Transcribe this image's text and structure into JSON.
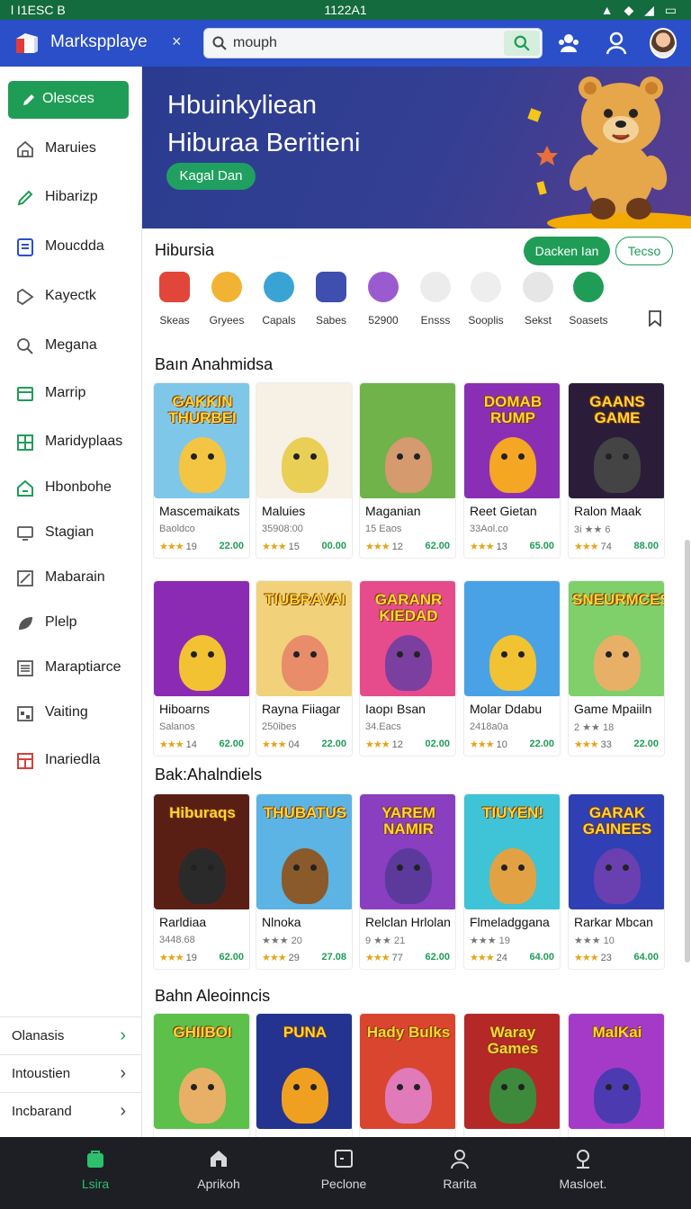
{
  "status_bar": {
    "left": "l I1ESC B",
    "time": "1122A1",
    "right": "▲ ◆ ◢ ▭"
  },
  "app": {
    "title": "Markspplaye",
    "close": "×"
  },
  "search": {
    "value": "mouph",
    "placeholder": "mouph"
  },
  "sidebar": {
    "primary": "Olesces",
    "items": [
      {
        "label": "Maruies",
        "icon": "home-icon"
      },
      {
        "label": "Hibarizp",
        "icon": "pencil-icon"
      },
      {
        "label": "Moucdda",
        "icon": "document-icon"
      },
      {
        "label": "Kayectk",
        "icon": "tag-icon"
      },
      {
        "label": "Megana",
        "icon": "search-icon"
      },
      {
        "label": "Marrip",
        "icon": "window-icon"
      },
      {
        "label": "Maridyplaas",
        "icon": "grid-icon"
      },
      {
        "label": "Hbonbohe",
        "icon": "house-icon"
      },
      {
        "label": "Stagian",
        "icon": "monitor-icon"
      },
      {
        "label": "Mabarain",
        "icon": "edit-icon"
      },
      {
        "label": "Plelp",
        "icon": "leaf-icon"
      },
      {
        "label": "Maraptiarce",
        "icon": "list-icon"
      },
      {
        "label": "Vaiting",
        "icon": "calendar-icon"
      },
      {
        "label": "Inariedla",
        "icon": "layout-icon"
      }
    ],
    "bottom": [
      "Olanasis",
      "Intoustien",
      "Incbarand"
    ]
  },
  "hero": {
    "line1": "Hbuinkyliean",
    "line2": "Hiburaa Beritieni",
    "cta": "Kagal Dan"
  },
  "categories_section": {
    "title": "Hibursia",
    "pill_primary": "Dacken Ian",
    "pill_secondary": "Tecso",
    "items": [
      {
        "label": "Skeas",
        "color": "#e2463a"
      },
      {
        "label": "Gryees",
        "color": "#f2b233"
      },
      {
        "label": "Capals",
        "color": "#39a3d6"
      },
      {
        "label": "Sabes",
        "color": "#3e4fb0"
      },
      {
        "label": "52900",
        "color": "#9b5bd0"
      },
      {
        "label": "Ensss",
        "color": "#d9d9d9"
      },
      {
        "label": "Sooplis",
        "color": "#e0e0e0"
      },
      {
        "label": "Sekst",
        "color": "#d0d0d0"
      },
      {
        "label": "Soasets",
        "color": "#1f9d57"
      }
    ]
  },
  "section1": {
    "title": "Baın Anahmidsa",
    "cards": [
      {
        "thumb_text": "GAKKIN THURBEI",
        "name": "Mascemaikats",
        "sub": "Baoldco",
        "stars": "★★★",
        "rating": "19",
        "price": "22.00",
        "bg": "#7fc7e8",
        "mascot": "#f4c542"
      },
      {
        "thumb_text": "",
        "name": "Maluies",
        "sub": "35908:00",
        "stars": "★★★",
        "rating": "15",
        "price": "00.00",
        "bg": "#f6f1e4",
        "mascot": "#e9cf56"
      },
      {
        "thumb_text": "",
        "name": "Maganian",
        "sub": "15 Eaos",
        "stars": "★★★",
        "rating": "12",
        "price": "62.00",
        "bg": "#6fb34a",
        "mascot": "#d59a6e"
      },
      {
        "thumb_text": "DOMAB RUMP",
        "name": "Reet Gietan",
        "sub": "33Aol.co",
        "stars": "★★★",
        "rating": "13",
        "price": "65.00",
        "bg": "#8a2fb5",
        "mascot": "#f5a623"
      },
      {
        "thumb_text": "GAANS GAME",
        "name": "Ralon Maak",
        "sub": "3i ★★ 6",
        "stars": "★★★",
        "rating": "74",
        "price": "88.00",
        "bg": "#2b1d3a",
        "mascot": "#444"
      }
    ]
  },
  "section2": {
    "cards": [
      {
        "thumb_text": "",
        "name": "Hiboarns",
        "sub": "Salanos",
        "stars": "★★★",
        "rating": "14",
        "price": "62.00",
        "bg": "#8b2bb3",
        "mascot": "#f2c232"
      },
      {
        "thumb_text": "TIUBRAVAI",
        "name": "Rayna Fiiagar",
        "sub": "250ibes",
        "stars": "★★★",
        "rating": "04",
        "price": "22.00",
        "bg": "#f1d17a",
        "mascot": "#e88c6a"
      },
      {
        "thumb_text": "GARANR KIEDAD",
        "name": "Iaopı Bsan",
        "sub": "34.Eacs",
        "stars": "★★★",
        "rating": "12",
        "price": "02.00",
        "bg": "#e64c8c",
        "mascot": "#7b3fa0"
      },
      {
        "thumb_text": "",
        "name": "Molar Ddabu",
        "sub": "2418a0a",
        "stars": "★★★",
        "rating": "10",
        "price": "22.00",
        "bg": "#4aa2e6",
        "mascot": "#f1c232"
      },
      {
        "thumb_text": "SNEURMCES",
        "name": "Game Mpaiiln",
        "sub": "2 ★★ 18",
        "stars": "★★★",
        "rating": "33",
        "price": "22.00",
        "bg": "#7fcf6b",
        "mascot": "#e8b067"
      }
    ]
  },
  "section3": {
    "title": "Bak:Ahalndiels",
    "cards": [
      {
        "thumb_text": "Hiburaqs",
        "name": "Rarldiaa",
        "sub": "3448.68",
        "stars": "★★★",
        "rating": "19",
        "price": "62.00",
        "bg": "#5a1f14",
        "mascot": "#2a2a2a"
      },
      {
        "thumb_text": "THUBATUS",
        "name": "Nlnoka",
        "sub": "★★★ 20",
        "stars": "★★★",
        "rating": "29",
        "price": "27.08",
        "bg": "#5bb4e3",
        "mascot": "#8a5a2b"
      },
      {
        "thumb_text": "YAREM NAMIR",
        "name": "Relclan Hrlolan",
        "sub": "9 ★★ 21",
        "stars": "★★★",
        "rating": "77",
        "price": "62.00",
        "bg": "#8a3ec0",
        "mascot": "#5b3a9c"
      },
      {
        "thumb_text": "TIUYEN!",
        "name": "Flmeladggana",
        "sub": "★★★ 19",
        "stars": "★★★",
        "rating": "24",
        "price": "64.00",
        "bg": "#3fc3d6",
        "mascot": "#e2a243"
      },
      {
        "thumb_text": "GARAK GAINEES",
        "name": "Rarkar Mbcan",
        "sub": "★★★ 10",
        "stars": "★★★",
        "rating": "23",
        "price": "64.00",
        "bg": "#2f3fb4",
        "mascot": "#6a3fb0"
      }
    ]
  },
  "section4": {
    "title": "Bahn Aleoinncis",
    "cards": [
      {
        "thumb_text": "GHIIBOI",
        "bg": "#5cc04a",
        "mascot": "#e8b067"
      },
      {
        "thumb_text": "PUNA",
        "bg": "#23338f",
        "mascot": "#f0a020"
      },
      {
        "thumb_text": "Hady Bulks",
        "bg": "#d9452f",
        "mascot": "#e07ab8"
      },
      {
        "thumb_text": "Waray Games",
        "bg": "#b52828",
        "mascot": "#3d8a3d"
      },
      {
        "thumb_text": "MalKai",
        "bg": "#a63ac8",
        "mascot": "#4c3bb0"
      }
    ]
  },
  "bottom_nav": [
    {
      "label": "Lsira",
      "icon": "store-icon",
      "active": true
    },
    {
      "label": "Aprikoh",
      "icon": "home-icon"
    },
    {
      "label": "Peclone",
      "icon": "screen-icon"
    },
    {
      "label": "Rarita",
      "icon": "user-icon"
    },
    {
      "label": "Masloet.",
      "icon": "chat-icon"
    }
  ],
  "colors": {
    "appbar": "#2a4fc9",
    "accent": "#1f9d57",
    "statusbar": "#146b3e",
    "bottom_nav": "#1d1f24"
  }
}
